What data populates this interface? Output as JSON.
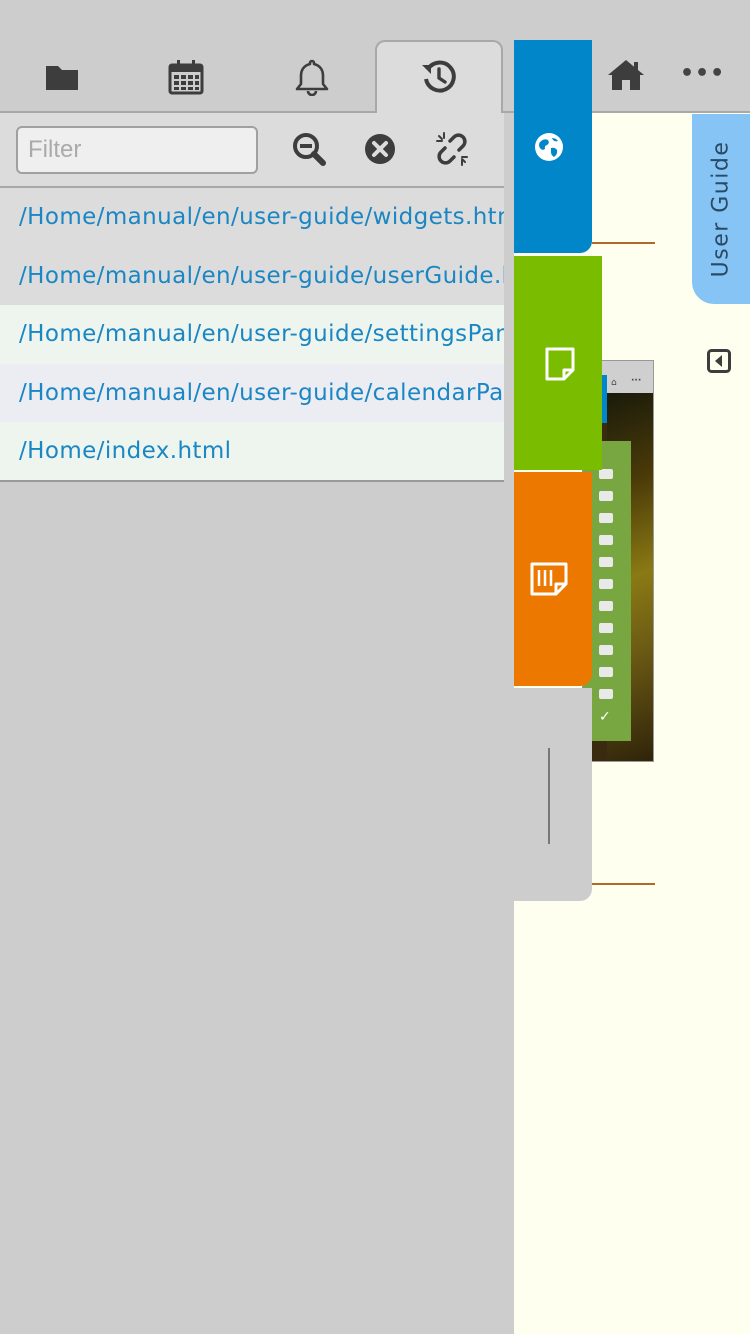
{
  "header": {
    "tabs": [
      {
        "id": "files",
        "icon": "folder-icon"
      },
      {
        "id": "calendar",
        "icon": "calendar-icon"
      },
      {
        "id": "notifications",
        "icon": "bell-icon"
      },
      {
        "id": "history",
        "icon": "history-icon",
        "active": true
      }
    ],
    "home_icon": "home-icon",
    "more_label": "•••"
  },
  "filter": {
    "placeholder": "Filter",
    "value": ""
  },
  "toolbar": {
    "zoom_out_icon": "zoom-out-icon",
    "clear_icon": "close-circle-icon",
    "unlink_icon": "unlink-icon"
  },
  "history": {
    "items": [
      {
        "label": "/Home/manual/en/user-guide/widgets.html"
      },
      {
        "label": "/Home/manual/en/user-guide/userGuide.html"
      },
      {
        "label": "/Home/manual/en/user-guide/settingsPanel.html"
      },
      {
        "label": "/Home/manual/en/user-guide/calendarPanel.html"
      },
      {
        "label": "/Home/index.html"
      }
    ]
  },
  "side_tabs": [
    {
      "id": "browser",
      "icon": "globe-icon",
      "color": "#0086c9"
    },
    {
      "id": "note",
      "icon": "note-icon",
      "color": "#79bc00"
    },
    {
      "id": "sticky-notes",
      "icon": "sticky-note-icon",
      "color": "#ec7800"
    }
  ],
  "user_guide": {
    "label": "User Guide"
  },
  "colors": {
    "link": "#1a86c3",
    "background": "#cdcdcd",
    "content_background": "#fffff0",
    "accent_rule": "#b0692a",
    "user_guide_tab": "#85c4f5"
  }
}
